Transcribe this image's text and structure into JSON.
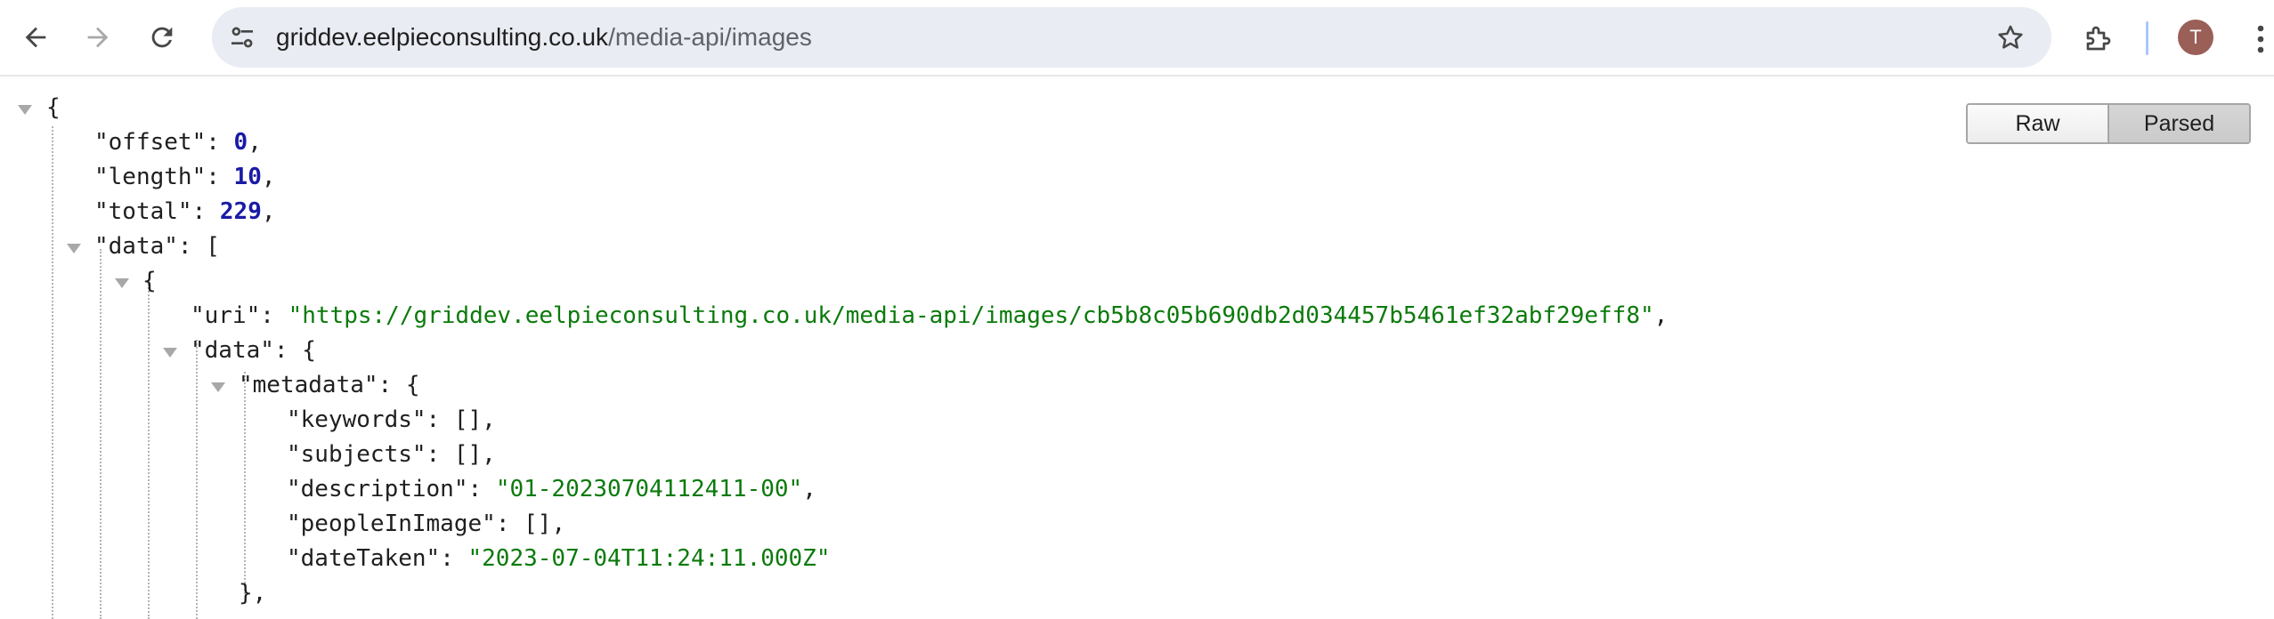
{
  "browser": {
    "url_host": "griddev.eelpieconsulting.co.uk",
    "url_path": "/media-api/images",
    "profile_initial": "T",
    "accent_color": "#a8c7fa",
    "avatar_color": "#9a5f57",
    "icons": [
      "back-arrow-icon",
      "forward-arrow-icon",
      "reload-icon",
      "site-info-icon",
      "bookmark-star-icon",
      "extensions-icon",
      "kebab-menu-icon"
    ]
  },
  "viewer": {
    "raw_label": "Raw",
    "parsed_label": "Parsed",
    "selected": "Parsed"
  },
  "json": {
    "offset_key": "\"offset\"",
    "offset_value": "0",
    "length_key": "\"length\"",
    "length_value": "10",
    "total_key": "\"total\"",
    "total_value": "229",
    "data_key": "\"data\"",
    "uri_key": "\"uri\"",
    "uri_value": "\"https://griddev.eelpieconsulting.co.uk/media-api/images/cb5b8c05b690db2d034457b5461ef32abf29eff8\"",
    "item_data_key": "\"data\"",
    "metadata_key": "\"metadata\"",
    "keywords_key": "\"keywords\"",
    "keywords_value": "[]",
    "subjects_key": "\"subjects\"",
    "subjects_value": "[]",
    "description_key": "\"description\"",
    "description_value": "\"01-20230704112411-00\"",
    "people_key": "\"peopleInImage\"",
    "people_value": "[]",
    "date_key": "\"dateTaken\"",
    "date_value": "\"2023-07-04T11:24:11.000Z\""
  }
}
